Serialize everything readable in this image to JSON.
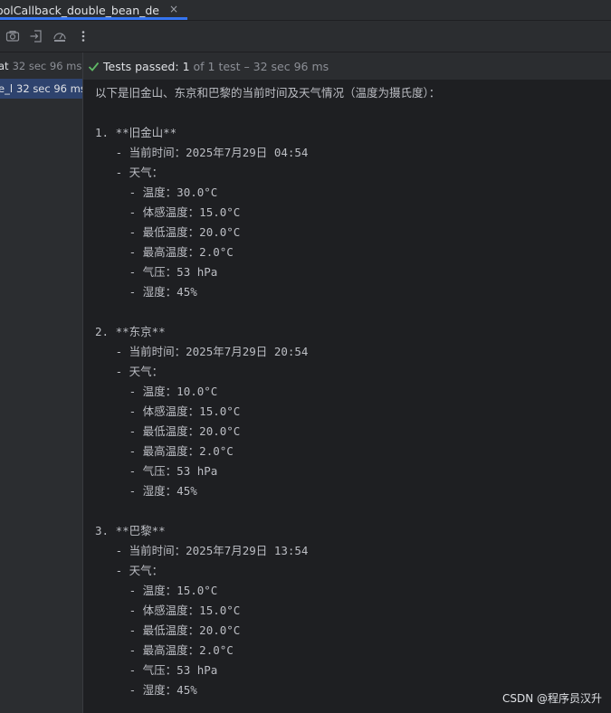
{
  "tab": {
    "title": "oolCallback_double_bean_de",
    "close_glyph": "×"
  },
  "toolbar": {
    "icons": [
      "camera-icon",
      "import-icon",
      "coverage-icon",
      "more-vertical-icon"
    ]
  },
  "sidebar": {
    "items": [
      {
        "name": "at",
        "time": "32 sec 96 ms"
      },
      {
        "name": "e_l",
        "time": "32 sec 96 ms"
      }
    ]
  },
  "status": {
    "label": "Tests passed:",
    "count": "1",
    "rest": "of 1 test – 32 sec 96 ms"
  },
  "console": {
    "lines": [
      "以下是旧金山、东京和巴黎的当前时间及天气情况（温度为摄氏度）：",
      "",
      "1. **旧金山**",
      "   - 当前时间：2025年7月29日 04:54",
      "   - 天气：",
      "     - 温度：30.0°C",
      "     - 体感温度：15.0°C",
      "     - 最低温度：20.0°C",
      "     - 最高温度：2.0°C",
      "     - 气压：53 hPa",
      "     - 湿度：45%",
      "",
      "2. **东京**",
      "   - 当前时间：2025年7月29日 20:54",
      "   - 天气：",
      "     - 温度：10.0°C",
      "     - 体感温度：15.0°C",
      "     - 最低温度：20.0°C",
      "     - 最高温度：2.0°C",
      "     - 气压：53 hPa",
      "     - 湿度：45%",
      "",
      "3. **巴黎**",
      "   - 当前时间：2025年7月29日 13:54",
      "   - 天气：",
      "     - 温度：15.0°C",
      "     - 体感温度：15.0°C",
      "     - 最低温度：20.0°C",
      "     - 最高温度：2.0°C",
      "     - 气压：53 hPa",
      "     - 湿度：45%"
    ]
  },
  "watermark": "CSDN @程序员汉升",
  "colors": {
    "accent": "#3574f0",
    "success": "#5fb865",
    "selection": "#2e436e",
    "background": "#1e1f22",
    "panel": "#2b2d30"
  }
}
